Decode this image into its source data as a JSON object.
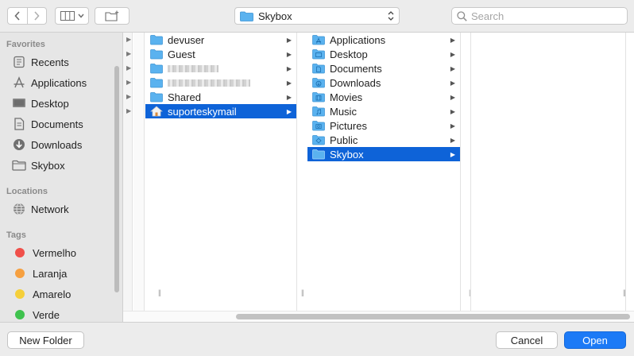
{
  "toolbar": {
    "back_icon": "chevron-left-icon",
    "forward_icon": "chevron-right-icon",
    "view_icon": "column-view-icon",
    "new_folder_icon": "new-folder-icon",
    "location": "Skybox",
    "search_placeholder": "Search"
  },
  "sidebar": {
    "favorites_heading": "Favorites",
    "favorites": [
      {
        "label": "Recents",
        "icon": "clock-icon"
      },
      {
        "label": "Applications",
        "icon": "applications-icon"
      },
      {
        "label": "Desktop",
        "icon": "desktop-icon"
      },
      {
        "label": "Documents",
        "icon": "document-icon"
      },
      {
        "label": "Downloads",
        "icon": "download-icon"
      },
      {
        "label": "Skybox",
        "icon": "folder-icon"
      }
    ],
    "locations_heading": "Locations",
    "locations": [
      {
        "label": "Network",
        "icon": "network-globe-icon"
      }
    ],
    "tags_heading": "Tags",
    "tags": [
      {
        "label": "Vermelho",
        "color": "#f0504a"
      },
      {
        "label": "Laranja",
        "color": "#f6a040"
      },
      {
        "label": "Amarelo",
        "color": "#f5cf3a"
      },
      {
        "label": "Verde",
        "color": "#3fc24e"
      }
    ]
  },
  "columns": {
    "users": [
      {
        "label": "devuser",
        "blurred": false,
        "selected": false
      },
      {
        "label": "Guest",
        "blurred": false,
        "selected": false
      },
      {
        "label": "",
        "blurred": true,
        "selected": false
      },
      {
        "label": "",
        "blurred": true,
        "selected": false
      },
      {
        "label": "Shared",
        "blurred": false,
        "selected": false
      },
      {
        "label": "suporteskymail",
        "blurred": false,
        "selected": true
      }
    ],
    "home": [
      {
        "label": "Applications",
        "selected": false
      },
      {
        "label": "Desktop",
        "selected": false
      },
      {
        "label": "Documents",
        "selected": false
      },
      {
        "label": "Downloads",
        "selected": false
      },
      {
        "label": "Movies",
        "selected": false
      },
      {
        "label": "Music",
        "selected": false
      },
      {
        "label": "Pictures",
        "selected": false
      },
      {
        "label": "Public",
        "selected": false
      },
      {
        "label": "Skybox",
        "selected": true
      }
    ]
  },
  "colors": {
    "selection": "#0e63d8",
    "primary_button": "#1c7af6",
    "folder": "#5ab2ef"
  },
  "buttons": {
    "new_folder": "New Folder",
    "cancel": "Cancel",
    "open": "Open"
  }
}
